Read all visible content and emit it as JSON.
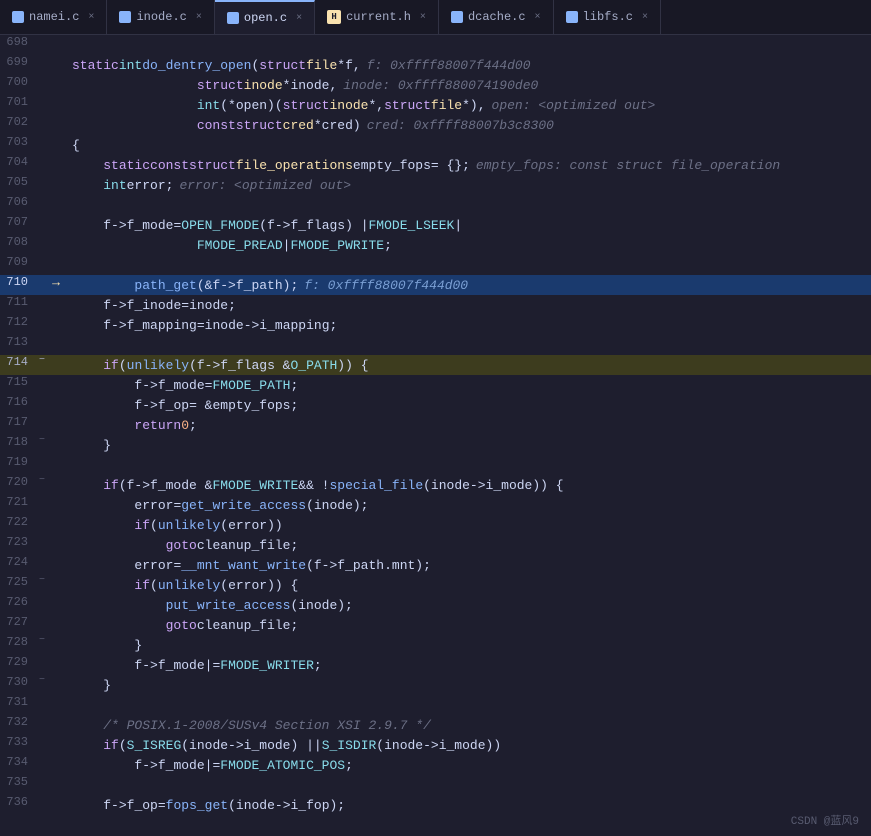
{
  "tabs": [
    {
      "id": "namei",
      "label": "namei.c",
      "icon_color": "#89b4fa",
      "active": false,
      "dot": false
    },
    {
      "id": "inode",
      "label": "inode.c",
      "icon_color": "#89b4fa",
      "active": false,
      "dot": false
    },
    {
      "id": "open",
      "label": "open.c",
      "icon_color": "#89b4fa",
      "active": true,
      "dot": false
    },
    {
      "id": "current",
      "label": "current.h",
      "icon_color": "#f9e2af",
      "active": false,
      "dot": false
    },
    {
      "id": "dcache",
      "label": "dcache.c",
      "icon_color": "#89b4fa",
      "active": false,
      "dot": false
    },
    {
      "id": "libfs",
      "label": "libfs.c",
      "icon_color": "#89b4fa",
      "active": false,
      "dot": false
    }
  ],
  "watermark": "CSDN @蓝风9",
  "lines": [
    {
      "num": 698,
      "fold": "",
      "arrow": false,
      "highlight": "",
      "code": ""
    },
    {
      "num": 699,
      "fold": "",
      "arrow": false,
      "highlight": "",
      "code": "static_int_do_dentry_open_hint"
    },
    {
      "num": 700,
      "fold": "",
      "arrow": false,
      "highlight": "",
      "code": "inode_line"
    },
    {
      "num": 701,
      "fold": "",
      "arrow": false,
      "highlight": "",
      "code": "open_line"
    },
    {
      "num": 702,
      "fold": "",
      "arrow": false,
      "highlight": "",
      "code": "cred_line"
    },
    {
      "num": 703,
      "fold": "",
      "arrow": false,
      "highlight": "",
      "code": "brace_open"
    },
    {
      "num": 704,
      "fold": "",
      "arrow": false,
      "highlight": "",
      "code": "empty_fops_line"
    },
    {
      "num": 705,
      "fold": "",
      "arrow": false,
      "highlight": "",
      "code": "error_line"
    },
    {
      "num": 706,
      "fold": "",
      "arrow": false,
      "highlight": "",
      "code": ""
    },
    {
      "num": 707,
      "fold": "",
      "arrow": false,
      "highlight": "",
      "code": "fmode_line1"
    },
    {
      "num": 708,
      "fold": "",
      "arrow": false,
      "highlight": "",
      "code": "fmode_line2"
    },
    {
      "num": 709,
      "fold": "",
      "arrow": false,
      "highlight": "",
      "code": ""
    },
    {
      "num": 710,
      "fold": "",
      "arrow": true,
      "highlight": "blue",
      "code": "path_get_line"
    },
    {
      "num": 711,
      "fold": "",
      "arrow": false,
      "highlight": "",
      "code": "f_inode_line"
    },
    {
      "num": 712,
      "fold": "",
      "arrow": false,
      "highlight": "",
      "code": "f_mapping_line"
    },
    {
      "num": 713,
      "fold": "",
      "arrow": false,
      "highlight": "",
      "code": ""
    },
    {
      "num": 714,
      "fold": "-",
      "arrow": false,
      "highlight": "yellow",
      "code": "if_unlikely_line"
    },
    {
      "num": 715,
      "fold": "",
      "arrow": false,
      "highlight": "",
      "code": "fmode_path_line"
    },
    {
      "num": 716,
      "fold": "",
      "arrow": false,
      "highlight": "",
      "code": "f_op_line"
    },
    {
      "num": 717,
      "fold": "",
      "arrow": false,
      "highlight": "",
      "code": "return_line"
    },
    {
      "num": 718,
      "fold": "-",
      "arrow": false,
      "highlight": "",
      "code": "brace_close"
    },
    {
      "num": 719,
      "fold": "",
      "arrow": false,
      "highlight": "",
      "code": ""
    },
    {
      "num": 720,
      "fold": "-",
      "arrow": false,
      "highlight": "",
      "code": "if_fmode_write_line"
    },
    {
      "num": 721,
      "fold": "",
      "arrow": false,
      "highlight": "",
      "code": "error_get_write"
    },
    {
      "num": 722,
      "fold": "",
      "arrow": false,
      "highlight": "",
      "code": "if_unlikely_error"
    },
    {
      "num": 723,
      "fold": "",
      "arrow": false,
      "highlight": "",
      "code": "goto_cleanup"
    },
    {
      "num": 724,
      "fold": "",
      "arrow": false,
      "highlight": "",
      "code": "error_mnt"
    },
    {
      "num": 725,
      "fold": "-",
      "arrow": false,
      "highlight": "",
      "code": "if_unlikely_error2"
    },
    {
      "num": 726,
      "fold": "",
      "arrow": false,
      "highlight": "",
      "code": "put_write"
    },
    {
      "num": 727,
      "fold": "",
      "arrow": false,
      "highlight": "",
      "code": "goto_cleanup2"
    },
    {
      "num": 728,
      "fold": "-",
      "arrow": false,
      "highlight": "",
      "code": "inner_brace"
    },
    {
      "num": 729,
      "fold": "",
      "arrow": false,
      "highlight": "",
      "code": "fmode_writer"
    },
    {
      "num": 730,
      "fold": "-",
      "arrow": false,
      "highlight": "",
      "code": "outer_brace"
    },
    {
      "num": 731,
      "fold": "",
      "arrow": false,
      "highlight": "",
      "code": ""
    },
    {
      "num": 732,
      "fold": "",
      "arrow": false,
      "highlight": "",
      "code": "posix_comment"
    },
    {
      "num": 733,
      "fold": "",
      "arrow": false,
      "highlight": "",
      "code": "if_isreg_line"
    },
    {
      "num": 734,
      "fold": "",
      "arrow": false,
      "highlight": "",
      "code": "fmode_atomic"
    },
    {
      "num": 735,
      "fold": "",
      "arrow": false,
      "highlight": "",
      "code": ""
    },
    {
      "num": 736,
      "fold": "",
      "arrow": false,
      "highlight": "",
      "code": "f_op_fops"
    }
  ]
}
